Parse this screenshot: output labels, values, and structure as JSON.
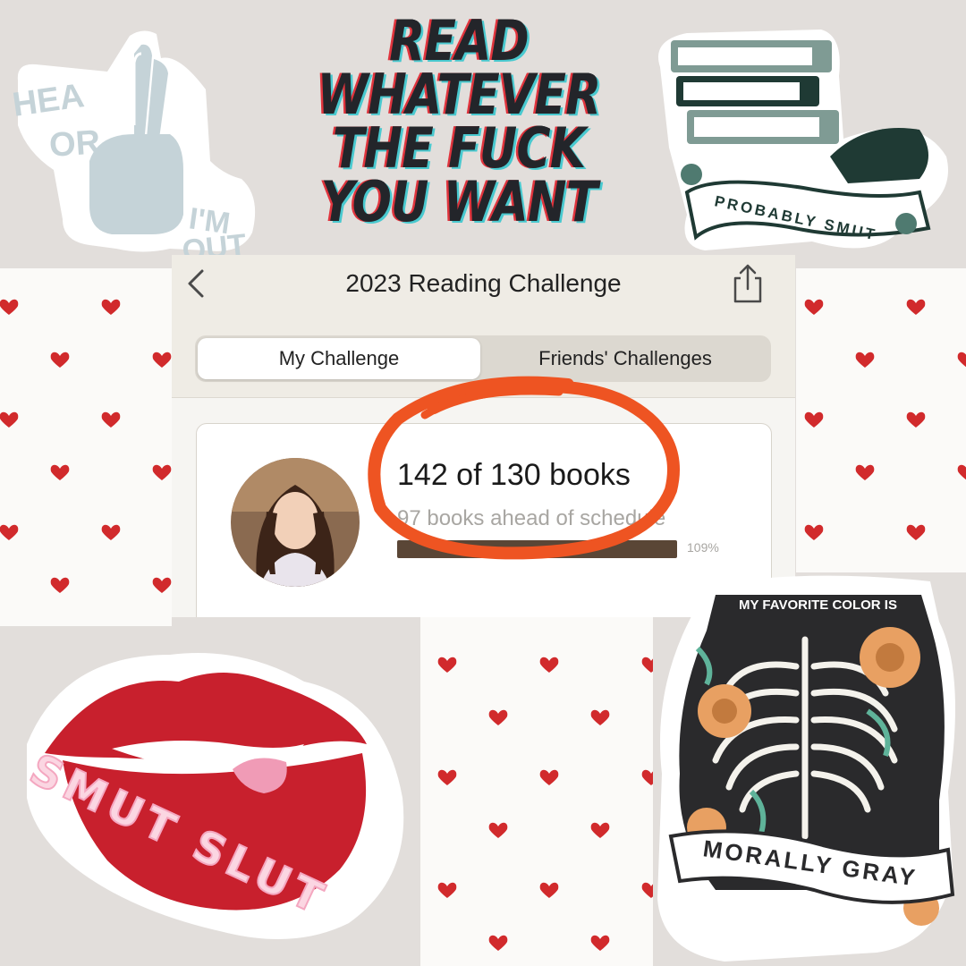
{
  "app": {
    "title": "2023 Reading Challenge",
    "tabs": [
      {
        "label": "My Challenge",
        "selected": true
      },
      {
        "label": "Friends' Challenges",
        "selected": false
      }
    ],
    "challenge": {
      "books_count": "142 of 130 books",
      "schedule_status": "97 books ahead of schedule",
      "progress_percent_label": "109%",
      "progress_fraction": 1.0
    }
  },
  "stickers": {
    "peace": {
      "line1": "HEA",
      "line2": "OR",
      "line3": "I'M",
      "line4": "OUT"
    },
    "headline": {
      "lines": [
        "READ",
        "WHATEVER",
        "THE FUCK",
        "YOU WANT"
      ]
    },
    "books": {
      "banner": "PROBABLY SMUT"
    },
    "lips": {
      "text": "SMUT SLUT"
    },
    "skeleton": {
      "top": "MY FAVORITE COLOR IS",
      "banner": "MORALLY GRAY"
    }
  },
  "colors": {
    "annotation_circle": "#ee5422",
    "heart": "#d12a2c",
    "progress_fill": "#5a4636",
    "lips": "#c8202d"
  },
  "icons": [
    "back-chevron-icon",
    "share-icon"
  ]
}
